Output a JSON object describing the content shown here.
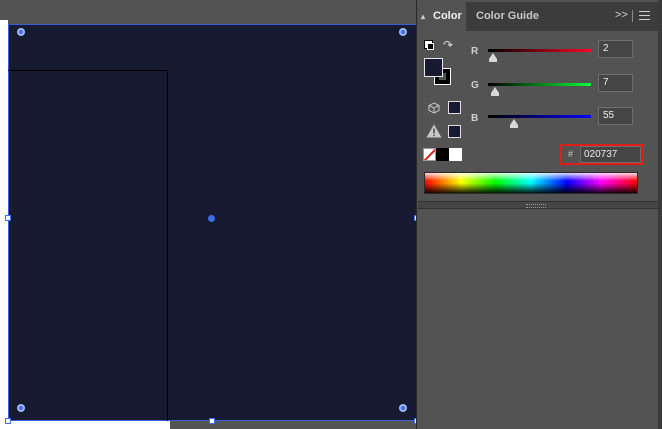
{
  "color_panel": {
    "tabs": {
      "color": "Color",
      "color_guide": "Color Guide",
      "more": ">>"
    },
    "fill_color": "#181a31",
    "channels": [
      {
        "label": "R",
        "value": "2",
        "level": 0.008,
        "gradient": [
          "#000000",
          "#ff0025"
        ]
      },
      {
        "label": "G",
        "value": "7",
        "level": 0.027,
        "gradient": [
          "#000000",
          "#07ff37"
        ]
      },
      {
        "label": "B",
        "value": "55",
        "level": 0.216,
        "gradient": [
          "#000000",
          "#0203ff"
        ]
      }
    ],
    "hex": {
      "hash": "#",
      "value": "020737",
      "highlight_color": "#e21b1b"
    },
    "icons": {
      "swap": "swap-arrow-icon",
      "default": "default-fill-stroke-icon",
      "websafe": "cube-icon",
      "gamut": "warning-icon",
      "menu": "hamburger-menu-icon"
    }
  },
  "canvas": {
    "artboard_fill": "#181a31",
    "selection_color": "#3d6ee8"
  }
}
